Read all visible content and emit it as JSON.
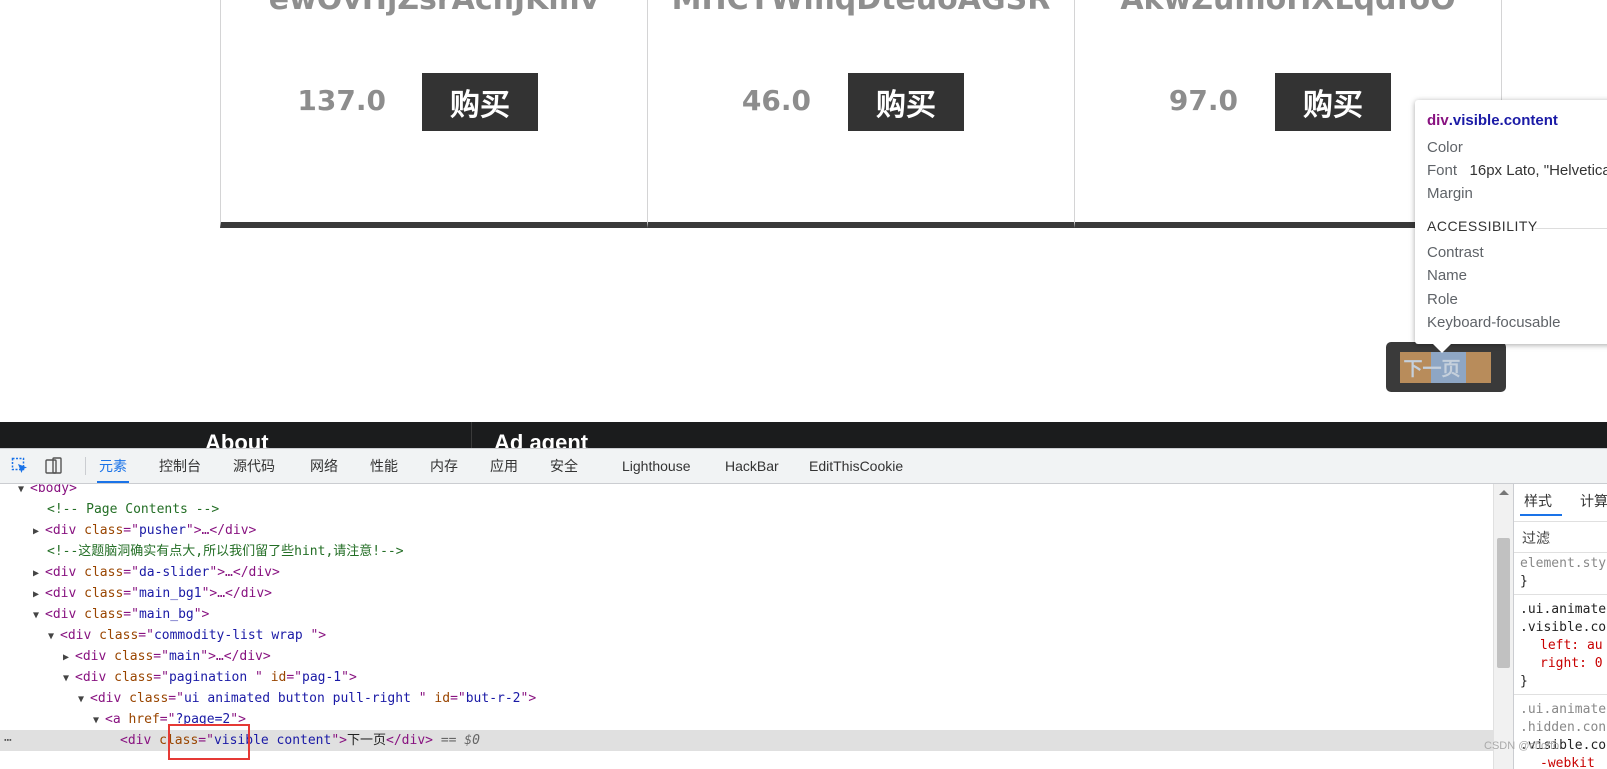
{
  "products": [
    {
      "title": "ewOvHjZsrAchJKmv",
      "price": "137.0",
      "buy_label": "购买"
    },
    {
      "title": "MHCYWmqDteuoAGSR",
      "price": "46.0",
      "buy_label": "购买"
    },
    {
      "title": "AkwZumoHXLqdfoO",
      "price": "97.0",
      "buy_label": "购买"
    }
  ],
  "pagination": {
    "next_label": "下一页"
  },
  "footer": {
    "left": "About",
    "right": "Ad agent"
  },
  "tooltip": {
    "selector_tag": "div",
    "selector_class": ".visible.content",
    "color_label": "Color",
    "font_label": "Font",
    "font_value": "16px Lato, \"Helvetica",
    "margin_label": "Margin",
    "accessibility_heading": "ACCESSIBILITY",
    "contrast_label": "Contrast",
    "name_label": "Name",
    "role_label": "Role",
    "keyboard_label": "Keyboard-focusable"
  },
  "devtools": {
    "tabs": [
      "元素",
      "控制台",
      "源代码",
      "网络",
      "性能",
      "内存",
      "应用",
      "安全",
      "Lighthouse",
      "HackBar",
      "EditThisCookie"
    ],
    "active_tab": "元素",
    "elements": {
      "l0": "<body>",
      "l1": "<!-- Page Contents -->",
      "l2_tag": "div",
      "l2_attr": "class",
      "l2_val": "pusher",
      "l3": "<!--这题脑洞确实有点大,所以我们留了些hint,请注意!-->",
      "l4_val": "da-slider",
      "l5_val": "main_bg1",
      "l6_val": "main_bg",
      "l7_val": "commodity-list wrap ",
      "l8_val": "main",
      "l9_val": "pagination ",
      "l9_id": "pag-1",
      "l10_val": "ui animated button pull-right ",
      "l10_id": "but-r-2",
      "l11_href": "?page=2",
      "l12_val": "visible content",
      "l12_text": "下一页",
      "l12_eq": "== $0"
    },
    "styles_panel": {
      "tabs": [
        "样式",
        "计算"
      ],
      "filter_label": "过滤",
      "rules": [
        {
          "line": "element.style"
        },
        {
          "line": "}"
        },
        {
          "line": ".ui.animate"
        },
        {
          "line": ".visible.co"
        },
        {
          "line": "left: au"
        },
        {
          "line": "right: 0"
        },
        {
          "line": "}"
        },
        {
          "line": ".ui.animate"
        },
        {
          "line": ".hidden.con"
        },
        {
          "line": ".visible.co"
        },
        {
          "line": "-webkit"
        }
      ]
    }
  },
  "watermark": "CSDN @choffo"
}
